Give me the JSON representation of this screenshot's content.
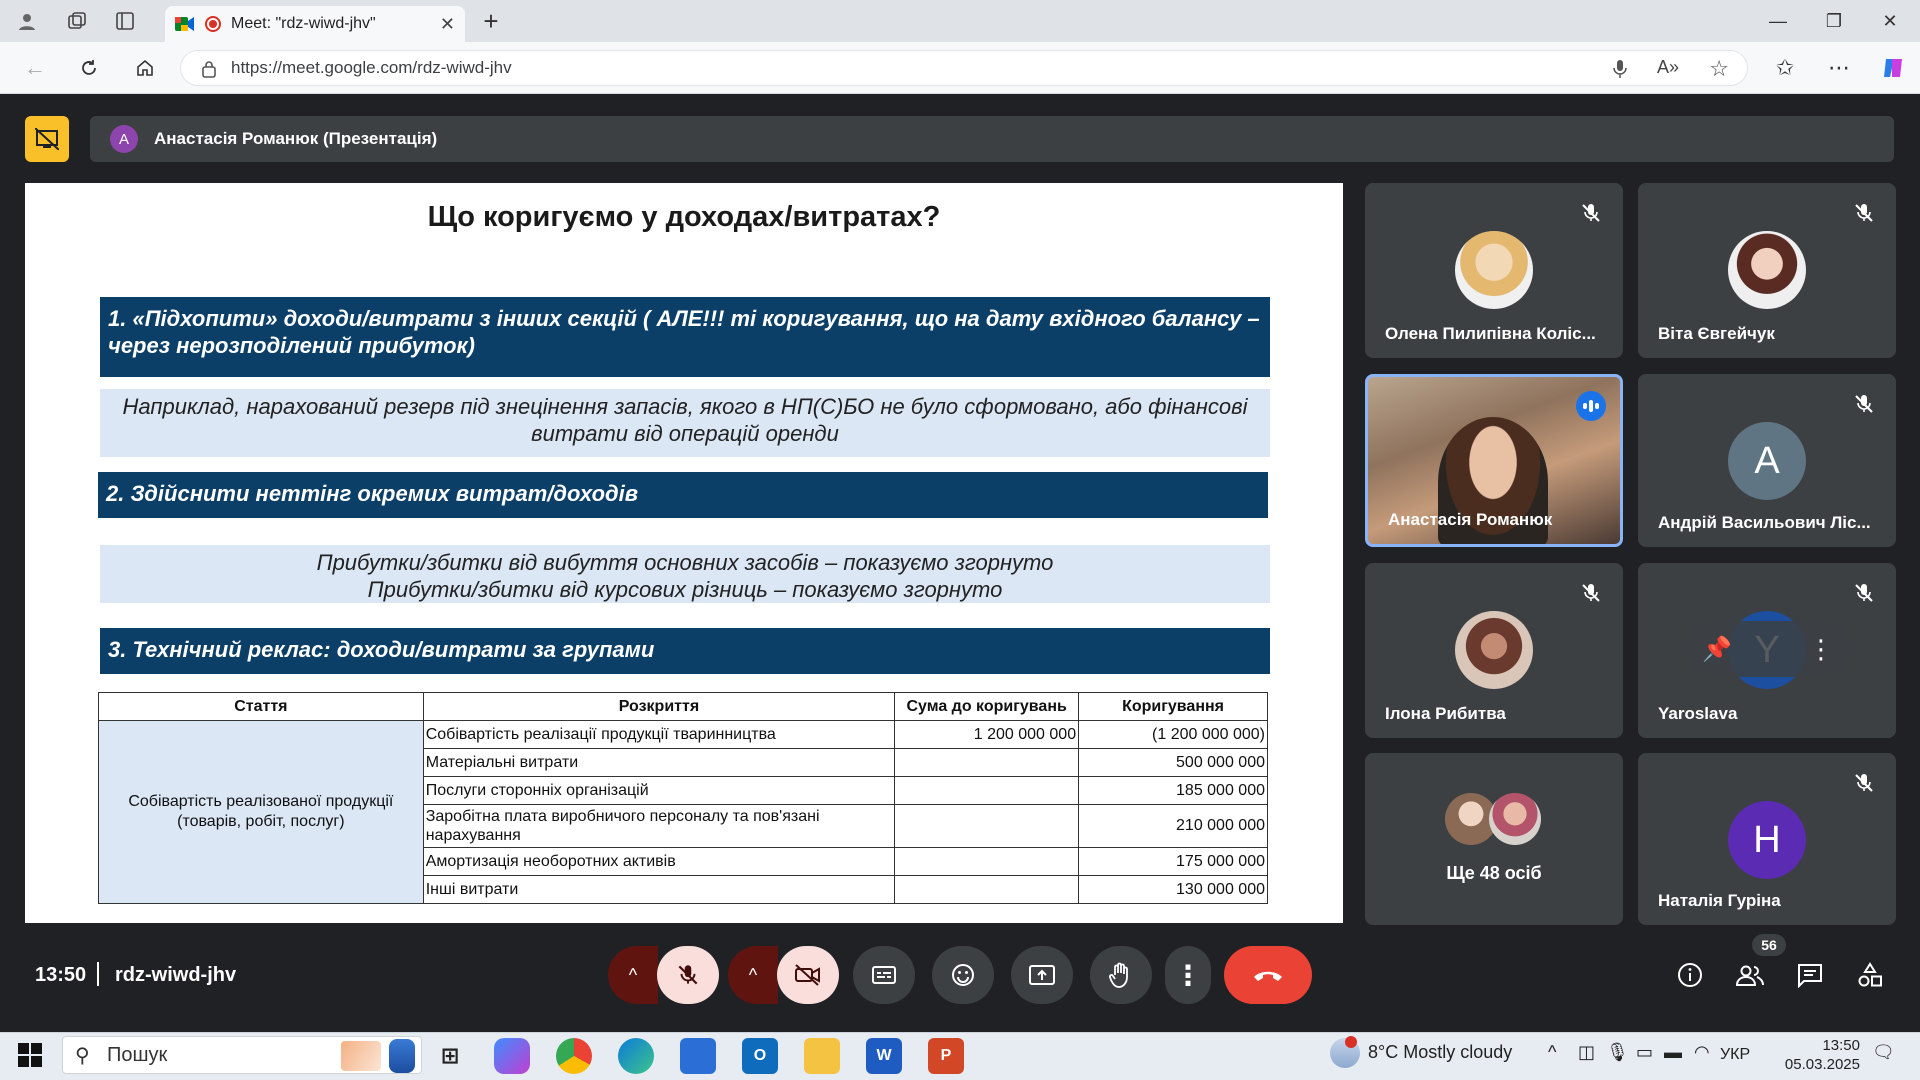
{
  "browser": {
    "tab_title": "Meet: \"rdz-wiwd-jhv\"",
    "url": "https://meet.google.com/rdz-wiwd-jhv"
  },
  "presenter_bar": {
    "avatar_letter": "A",
    "label": "Анастасія Романюк (Презентація)"
  },
  "slide": {
    "title": "Що коригуємо у доходах/витратах?",
    "section1": "1. «Підхопити» доходи/витрати з інших секцій ( АЛЕ!!! ті коригування, що на дату вхідного балансу – через нерозподілений прибуток)",
    "note1": "Наприклад, нарахований резерв під знецінення запасів, якого в НП(С)БО не було сформовано, або фінансові витрати від операцій оренди",
    "section2": "2. Здійснити неттінг окремих витрат/доходів",
    "note2_line1": "Прибутки/збитки від вибуття основних засобів – показуємо згорнуто",
    "note2_line2": "Прибутки/збитки від курсових різниць – показуємо згорнуто",
    "section3": "3. Технічний реклас: доходи/витрати за групами",
    "table": {
      "headers": [
        "Стаття",
        "Розкриття",
        "Сума до коригувань",
        "Коригування"
      ],
      "merged_cell": "Собівартість реалізованої продукції (товарів, робіт, послуг)",
      "rows": [
        {
          "detail": "Собівартість реалізації продукції тваринництва",
          "amount": "1 200 000 000",
          "adj": "(1 200 000 000)"
        },
        {
          "detail": "Матеріальні витрати",
          "amount": "",
          "adj": "500 000 000"
        },
        {
          "detail": "Послуги сторонніх організацій",
          "amount": "",
          "adj": "185 000 000"
        },
        {
          "detail": "Заробітна плата виробничого персоналу та пов'язані нарахування",
          "amount": "",
          "adj": "210 000 000"
        },
        {
          "detail": "Амортизація необоротних активів",
          "amount": "",
          "adj": "175 000 000"
        },
        {
          "detail": "Інші витрати",
          "amount": "",
          "adj": "130 000 000"
        }
      ]
    }
  },
  "participants": [
    {
      "name": "Олена Пилипівна Коліс...",
      "type": "photo",
      "color": "#e7c49a"
    },
    {
      "name": "Віта Євгейчук",
      "type": "photo",
      "color": "#b07a6b"
    },
    {
      "name": "Анастасія Романюк",
      "type": "video"
    },
    {
      "name": "Андрій Васильович Ліс...",
      "type": "letter",
      "letter": "А",
      "color": "#5f7584"
    },
    {
      "name": "Ілона Рибитва",
      "type": "photo",
      "color": "#6b3a2f"
    },
    {
      "name": "Yaroslava",
      "type": "letter",
      "letter": "Y",
      "color": "#1d4fa0"
    },
    {
      "name": "Ще 48 осіб",
      "type": "group"
    },
    {
      "name": "Наталія Гуріна",
      "type": "letter",
      "letter": "Н",
      "color": "#5b2bb3"
    }
  ],
  "bottom": {
    "time": "13:50",
    "meeting_code": "rdz-wiwd-jhv",
    "people_count": "56"
  },
  "taskbar": {
    "search_placeholder": "Пошук",
    "weather": "8°C  Mostly cloudy",
    "lang": "УКР",
    "time": "13:50",
    "date": "05.03.2025"
  }
}
